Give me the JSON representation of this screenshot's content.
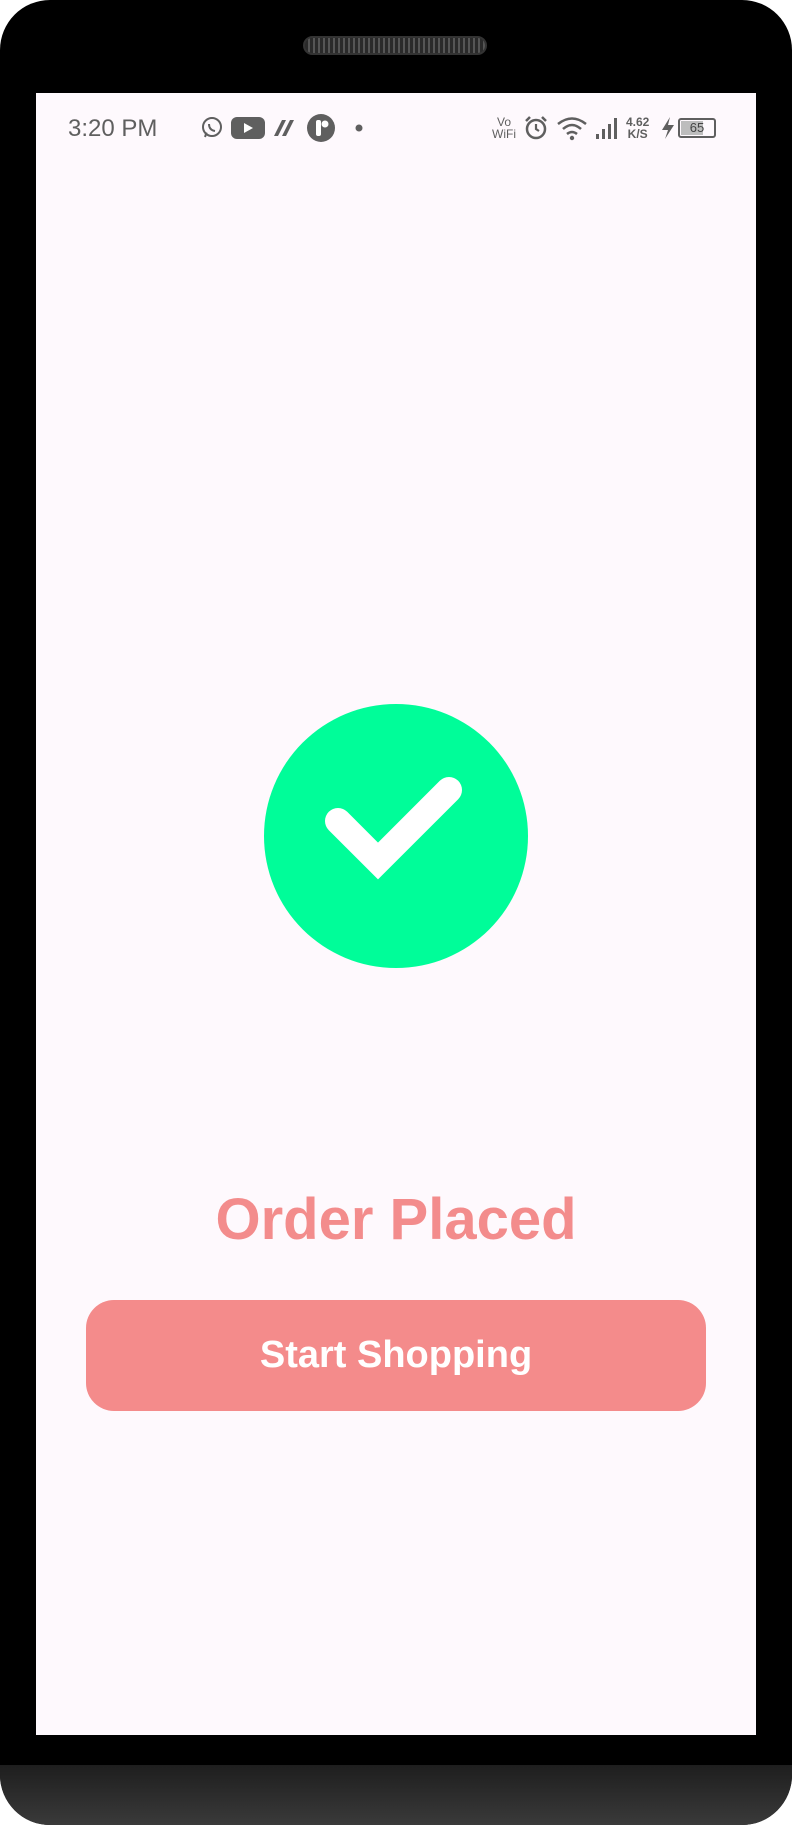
{
  "status_bar": {
    "time": "3:20 PM",
    "notification_icons": [
      "whatsapp-icon",
      "youtube-icon",
      "app-icon",
      "r-app-icon",
      "dot-icon"
    ],
    "vowifi_top": "Vo",
    "vowifi_bottom": "WiFi",
    "speed_value": "4.62",
    "speed_unit": "K/S",
    "battery": "65"
  },
  "main": {
    "success_icon": "check-circle-icon",
    "title": "Order Placed",
    "button_label": "Start Shopping"
  },
  "colors": {
    "success": "#00fd99",
    "accent": "#f48b8b",
    "background": "#fef9fd"
  }
}
